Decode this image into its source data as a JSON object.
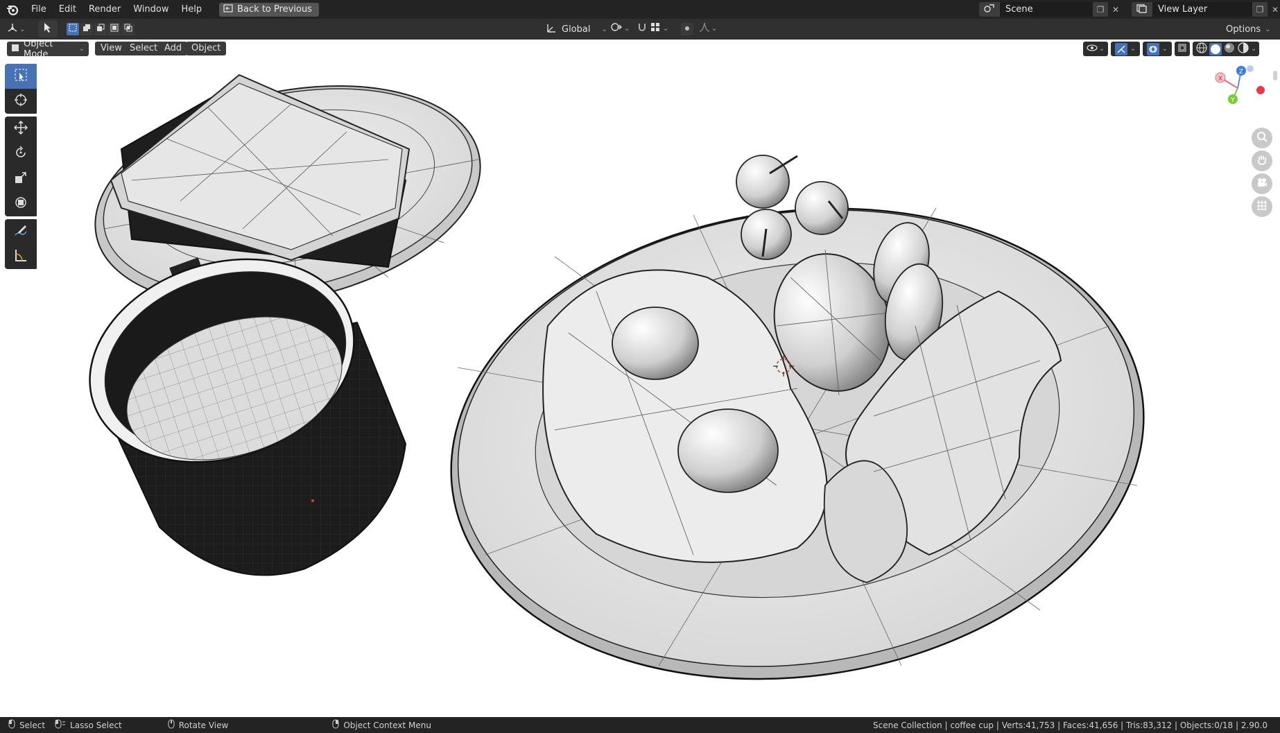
{
  "menu": {
    "items": [
      "File",
      "Edit",
      "Render",
      "Window",
      "Help"
    ]
  },
  "back_button": {
    "label": "Back to Previous"
  },
  "scene": {
    "label": "Scene"
  },
  "view_layer": {
    "label": "View Layer"
  },
  "toolheader": {
    "transform_orientation": "Global",
    "options_label": "Options"
  },
  "viewport_header": {
    "mode": "Object Mode",
    "menus": [
      "View",
      "Select",
      "Add",
      "Object"
    ]
  },
  "gizmo": {
    "x": "X",
    "y": "Y",
    "z": "Z"
  },
  "statusbar": {
    "select": "Select",
    "lasso": "Lasso Select",
    "rotate": "Rotate View",
    "context": "Object Context Menu",
    "info": "Scene Collection | coffee cup | Verts:41,753 | Faces:41,656 | Tris:83,312 | Objects:0/18 | 2.90.0"
  },
  "colors": {
    "accent": "#4772b3",
    "topbar": "#232323",
    "header": "#303030"
  }
}
